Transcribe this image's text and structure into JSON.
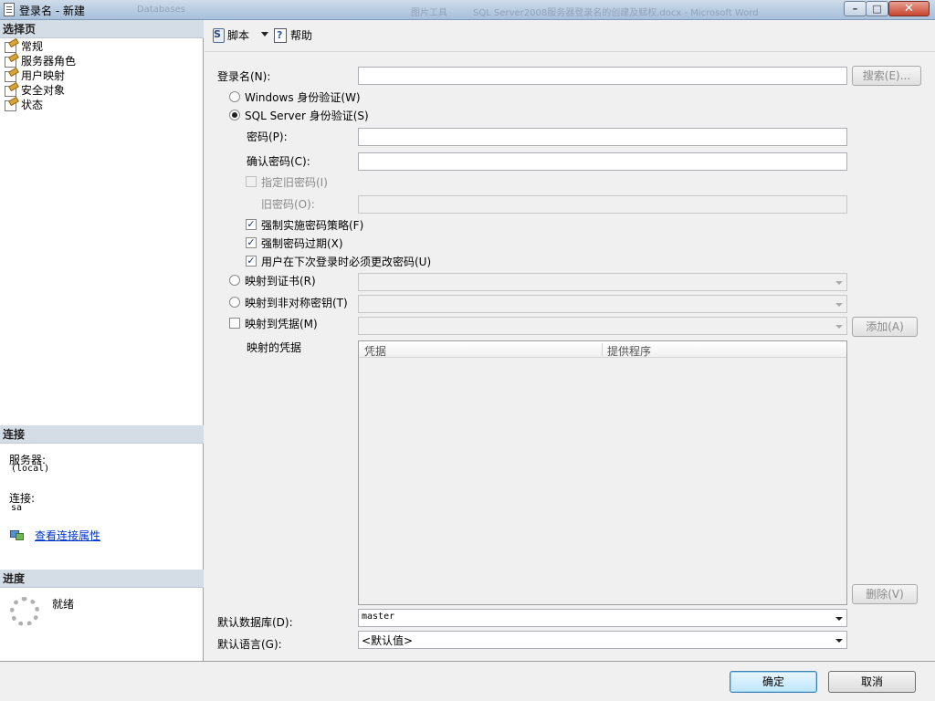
{
  "window": {
    "title": "登录名 - 新建",
    "ghost_text_1": "Databases",
    "ghost_text_2": "图片工具",
    "ghost_text_3": "SQL Server2008服务器登录名的创建及赋权.docx - Microsoft Word",
    "minimize_glyph": "–",
    "maximize_glyph": "□",
    "close_glyph": "✕"
  },
  "left": {
    "select_page_header": "选择页",
    "pages": [
      "常规",
      "服务器角色",
      "用户映射",
      "安全对象",
      "状态"
    ],
    "connection_header": "连接",
    "server_label": "服务器:",
    "server_value": "(local)",
    "connection_label": "连接:",
    "connection_value": "sa",
    "view_props_link": "查看连接属性",
    "progress_header": "进度",
    "progress_status": "就绪"
  },
  "toolbar": {
    "script_label": "脚本",
    "help_label": "帮助"
  },
  "form": {
    "login_name_label": "登录名(N):",
    "search_button": "搜索(E)...",
    "windows_auth_label": "Windows 身份验证(W)",
    "sql_auth_label": "SQL Server 身份验证(S)",
    "auth_selected": "sql",
    "password_label": "密码(P):",
    "confirm_password_label": "确认密码(C):",
    "specify_old_password_label": "指定旧密码(I)",
    "old_password_label": "旧密码(O):",
    "enforce_policy_label": "强制实施密码策略(F)",
    "enforce_policy_checked": true,
    "enforce_expiration_label": "强制密码过期(X)",
    "enforce_expiration_checked": true,
    "must_change_label": "用户在下次登录时必须更改密码(U)",
    "must_change_checked": true,
    "map_cert_label": "映射到证书(R)",
    "map_asym_key_label": "映射到非对称密钥(T)",
    "map_credential_label": "映射到凭据(M)",
    "add_button": "添加(A)",
    "mapped_credentials_label": "映射的凭据",
    "grid_columns": [
      "凭据",
      "提供程序"
    ],
    "remove_button": "删除(V)",
    "default_db_label": "默认数据库(D):",
    "default_db_value": "master",
    "default_lang_label": "默认语言(G):",
    "default_lang_value": "<默认值>"
  },
  "footer": {
    "ok_label": "确定",
    "cancel_label": "取消"
  }
}
